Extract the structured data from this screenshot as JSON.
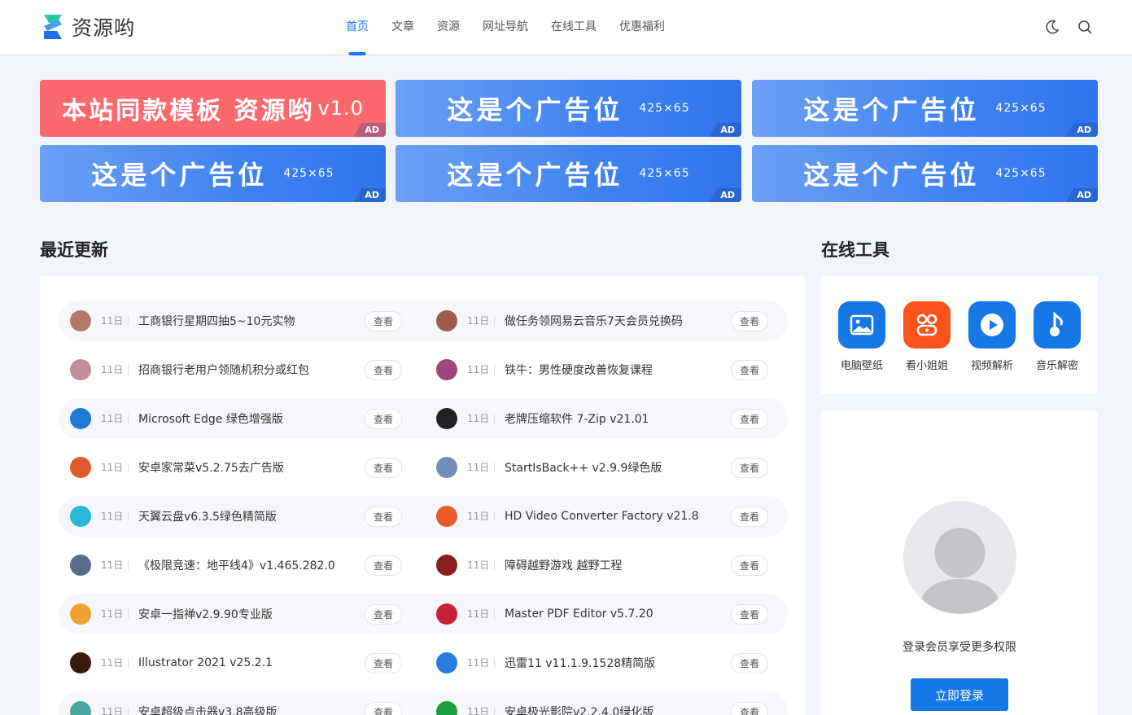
{
  "header": {
    "logo_text": "资源哟",
    "nav": [
      {
        "label": "首页",
        "active": true
      },
      {
        "label": "文章"
      },
      {
        "label": "资源"
      },
      {
        "label": "网址导航"
      },
      {
        "label": "在线工具"
      },
      {
        "label": "优惠福利"
      }
    ],
    "icons": [
      "moon-icon",
      "search-icon"
    ]
  },
  "ads": [
    {
      "text": "本站同款模板 资源哟",
      "size": "v1.0",
      "tag": "AD",
      "color": "#fd6a6e"
    },
    {
      "text": "这是个广告位",
      "size": "425×65",
      "tag": "AD",
      "color": "#3e82f0"
    },
    {
      "text": "这是个广告位",
      "size": "425×65",
      "tag": "AD",
      "color": "#3e82f0"
    },
    {
      "text": "这是个广告位",
      "size": "425×65",
      "tag": "AD",
      "color": "#3e82f0"
    },
    {
      "text": "这是个广告位",
      "size": "425×65",
      "tag": "AD",
      "color": "#3e82f0"
    },
    {
      "text": "这是个广告位",
      "size": "425×65",
      "tag": "AD",
      "color": "#3e82f0"
    }
  ],
  "recent": {
    "title": "最近更新",
    "view_label": "查看",
    "rows": [
      [
        {
          "date": "11日",
          "title": "工商银行星期四抽5~10元实物",
          "icon": "bank-icon"
        },
        {
          "date": "11日",
          "title": "做任务领网易云音乐7天会员兑换码",
          "icon": "music-card-icon"
        }
      ],
      [
        {
          "date": "11日",
          "title": "招商银行老用户领随机积分或红包",
          "icon": "bank-icon"
        },
        {
          "date": "11日",
          "title": "铁牛：男性硬度改善恢复课程",
          "icon": "course-icon"
        }
      ],
      [
        {
          "date": "11日",
          "title": "Microsoft Edge 绿色增强版",
          "icon": "edge-icon"
        },
        {
          "date": "11日",
          "title": "老牌压缩软件 7-Zip v21.01",
          "icon": "7zip-icon"
        }
      ],
      [
        {
          "date": "11日",
          "title": "安卓家常菜v5.2.75去广告版",
          "icon": "food-icon"
        },
        {
          "date": "11日",
          "title": "StartIsBack++ v2.9.9绿色版",
          "icon": "startmenu-icon"
        }
      ],
      [
        {
          "date": "11日",
          "title": "天翼云盘v6.3.5绿色精简版",
          "icon": "cloud-icon"
        },
        {
          "date": "11日",
          "title": "HD Video Converter Factory v21.8",
          "icon": "video-converter-icon"
        }
      ],
      [
        {
          "date": "11日",
          "title": "《极限竞速：地平线4》v1.465.282.0",
          "icon": "game-icon"
        },
        {
          "date": "11日",
          "title": "障碍越野游戏 越野工程",
          "icon": "offroad-icon"
        }
      ],
      [
        {
          "date": "11日",
          "title": "安卓一指禅v2.9.90专业版",
          "icon": "finger-icon"
        },
        {
          "date": "11日",
          "title": "Master PDF Editor v5.7.20",
          "icon": "pdf-icon"
        }
      ],
      [
        {
          "date": "11日",
          "title": "Illustrator 2021 v25.2.1",
          "icon": "illustrator-icon"
        },
        {
          "date": "11日",
          "title": "迅雷11 v11.1.9.1528精简版",
          "icon": "thunder-icon"
        }
      ],
      [
        {
          "date": "11日",
          "title": "安卓超级点击器v3.8高级版",
          "icon": "clicker-icon"
        },
        {
          "date": "11日",
          "title": "安卓极光影院v2.2.4.0绿化版",
          "icon": "cinema-icon"
        }
      ]
    ]
  },
  "tools": {
    "title": "在线工具",
    "items": [
      {
        "label": "电脑壁纸",
        "icon": "wallpaper-icon",
        "color": "#1677e6"
      },
      {
        "label": "看小姐姐",
        "icon": "video-grid-icon",
        "color": "#fa541c"
      },
      {
        "label": "视频解析",
        "icon": "play-icon",
        "color": "#1677e6"
      },
      {
        "label": "音乐解密",
        "icon": "music-note-icon",
        "color": "#1677e6"
      }
    ]
  },
  "login": {
    "text": "登录会员享受更多权限",
    "button": "立即登录"
  }
}
